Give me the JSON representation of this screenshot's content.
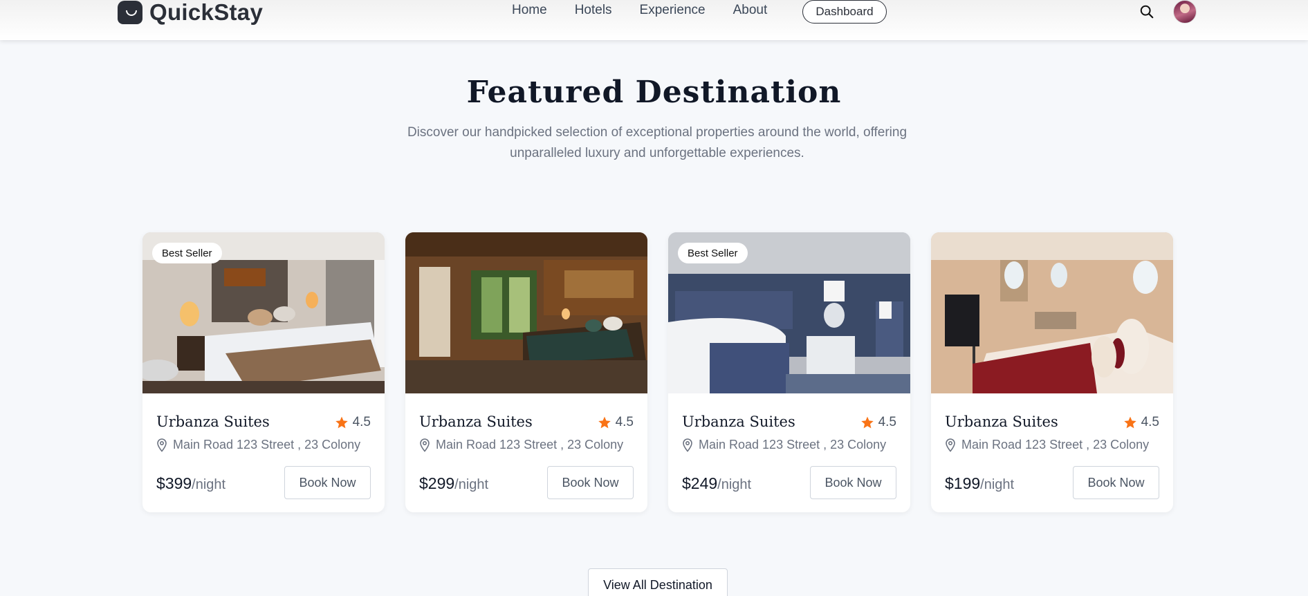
{
  "nav": {
    "logo_text": "QuickStay",
    "links": [
      "Home",
      "Hotels",
      "Experience",
      "About"
    ],
    "dashboard_label": "Dashboard"
  },
  "section": {
    "title": "Featured Destination",
    "subtitle": "Discover our handpicked selection of exceptional properties around the world, offering unparalleled luxury and unforgettable experiences."
  },
  "cards": [
    {
      "badge": "Best Seller",
      "name": "Urbanza Suites",
      "rating": "4.5",
      "address": "Main Road 123 Street , 23 Colony",
      "price": "$399",
      "unit": "/night",
      "book_label": "Book Now"
    },
    {
      "badge": "",
      "name": "Urbanza Suites",
      "rating": "4.5",
      "address": "Main Road 123 Street , 23 Colony",
      "price": "$299",
      "unit": "/night",
      "book_label": "Book Now"
    },
    {
      "badge": "Best Seller",
      "name": "Urbanza Suites",
      "rating": "4.5",
      "address": "Main Road 123 Street , 23 Colony",
      "price": "$249",
      "unit": "/night",
      "book_label": "Book Now"
    },
    {
      "badge": "",
      "name": "Urbanza Suites",
      "rating": "4.5",
      "address": "Main Road 123 Street , 23 Colony",
      "price": "$199",
      "unit": "/night",
      "book_label": "Book Now"
    }
  ],
  "view_all_label": "View All Destination",
  "colors": {
    "star": "#f97316",
    "background": "#f6f8fb",
    "text": "#111827"
  }
}
